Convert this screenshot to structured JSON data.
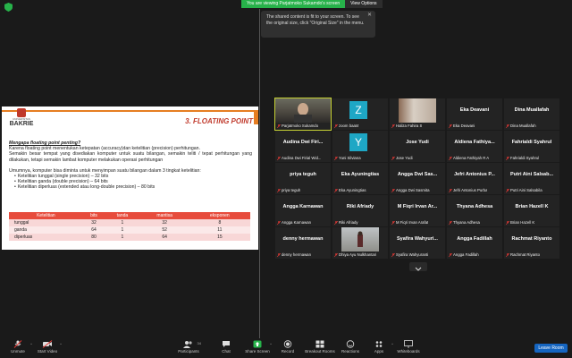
{
  "banner": {
    "viewing": "You are viewing Parjatmoko Sukamdo's screen",
    "view_options": "View Options"
  },
  "tooltip": {
    "text": "The shared content is fit to your screen. To see the original size, click \"Original Size\" in the menu."
  },
  "slide": {
    "logo_sub": "UNIVERSITAS",
    "logo_name": "BAKRIE",
    "title": "3. FLOATING POINT",
    "question": "Mengapa floating point penting?",
    "para1": "Karena floating point menentukan ketepatan (accuracy)dan ketelitian (precision) perhitungan.",
    "para2": "Semakin besar tempat yang disediakan komputer untuk suatu bilangan, semakin teliti / tepat perhitungan yang dilakukan, tetapi semakin lambat komputer melakukan operasi perhitungan",
    "para3": "Umumnya, komputer bisa diminta untuk menyimpan suatu bilangan dalam 3 tingkat ketelitian:",
    "bullets": [
      "Ketelitian tunggal (single precision) – 32 bits",
      "Ketelitian ganda (double precision) – 64 bits",
      "Ketelitian diperluas (extended atau long-double precision) – 80 bits"
    ],
    "table": {
      "headers": [
        "Ketelitian",
        "bits",
        "tanda",
        "mantisa",
        "eksponen"
      ],
      "rows": [
        [
          "tunggal",
          "32",
          "1",
          "32",
          "8"
        ],
        [
          "ganda",
          "64",
          "1",
          "52",
          "11"
        ],
        [
          "diperluas",
          "80",
          "1",
          "64",
          "15"
        ]
      ]
    }
  },
  "participants": [
    {
      "display": "",
      "label": "Parjatmoko Sukamdo",
      "type": "video",
      "active": true
    },
    {
      "display": "Z",
      "label": "zoom baat4",
      "type": "avatar"
    },
    {
      "display": "",
      "label": "Haliza Fahira S",
      "type": "photo"
    },
    {
      "display": "Eka Deavani",
      "label": "Eka Deavani",
      "type": "name"
    },
    {
      "display": "Dina Muallafah",
      "label": "Dina Muallafah",
      "type": "name"
    },
    {
      "display": "Audina Dwi Firi...",
      "label": "Audina Dwi Firial Wid...",
      "type": "name"
    },
    {
      "display": "Y",
      "label": "Yuni Silviana",
      "type": "avatar"
    },
    {
      "display": "Jose Yudi",
      "label": "Jose Yudi",
      "type": "name"
    },
    {
      "display": "Aldiena Fathiya...",
      "label": "Aldiena Fathiyah R A",
      "type": "name"
    },
    {
      "display": "Fahrialdi Syahrul",
      "label": "Fahrialdi Syahrul",
      "type": "name"
    },
    {
      "display": "priya teguh",
      "label": "priya teguh",
      "type": "name"
    },
    {
      "display": "Eka Ayuningtias",
      "label": "Eka Ayuningtias",
      "type": "name"
    },
    {
      "display": "Angga Dwi Sas...",
      "label": "Angga Dwi Sasmita",
      "type": "name"
    },
    {
      "display": "Jefri Antonius P...",
      "label": "Jefri Antonius Purba",
      "type": "name"
    },
    {
      "display": "Putri Aini Salsab...",
      "label": "Putri Aini Salsabila",
      "type": "name"
    },
    {
      "display": "Angga Karnawan",
      "label": "Angga Karnawan",
      "type": "name"
    },
    {
      "display": "Riki Afriady",
      "label": "Riki Afriady",
      "type": "name"
    },
    {
      "display": "M Fiqri Irvan Ar...",
      "label": "M Fiqri Irvan Arafat",
      "type": "name"
    },
    {
      "display": "Thyana Adhesa",
      "label": "Thyana Adhesa",
      "type": "name"
    },
    {
      "display": "Brian Hazell K",
      "label": "Brian Hazell K",
      "type": "name"
    },
    {
      "display": "denny hermawan",
      "label": "denny hermawan",
      "type": "name"
    },
    {
      "display": "",
      "label": "Dhiya Ayu Nulkhantari",
      "type": "photo2"
    },
    {
      "display": "Syafira Wahyuri...",
      "label": "Syafira Wahyuranti",
      "type": "name"
    },
    {
      "display": "Angga Fadillah",
      "label": "Angga Fadillah",
      "type": "name"
    },
    {
      "display": "Rachmat Riyanto",
      "label": "Rachmat Riyanto",
      "type": "name"
    }
  ],
  "toolbar": {
    "unmute": "Unmute",
    "start_video": "Start Video",
    "participants": "Participants",
    "participants_count": "34",
    "chat": "Chat",
    "share_screen": "Share Screen",
    "record": "Record",
    "breakout": "Breakout Rooms",
    "reactions": "Reactions",
    "apps": "Apps",
    "whiteboards": "Whiteboards",
    "leave": "Leave Room"
  },
  "colors": {
    "banner_green": "#27b24a",
    "slide_accent": "#e74c3c",
    "active_speaker": "#c7d234",
    "avatar_teal": "#1ea7c5",
    "leave_blue": "#1565c0",
    "share_green": "#27b24a"
  }
}
